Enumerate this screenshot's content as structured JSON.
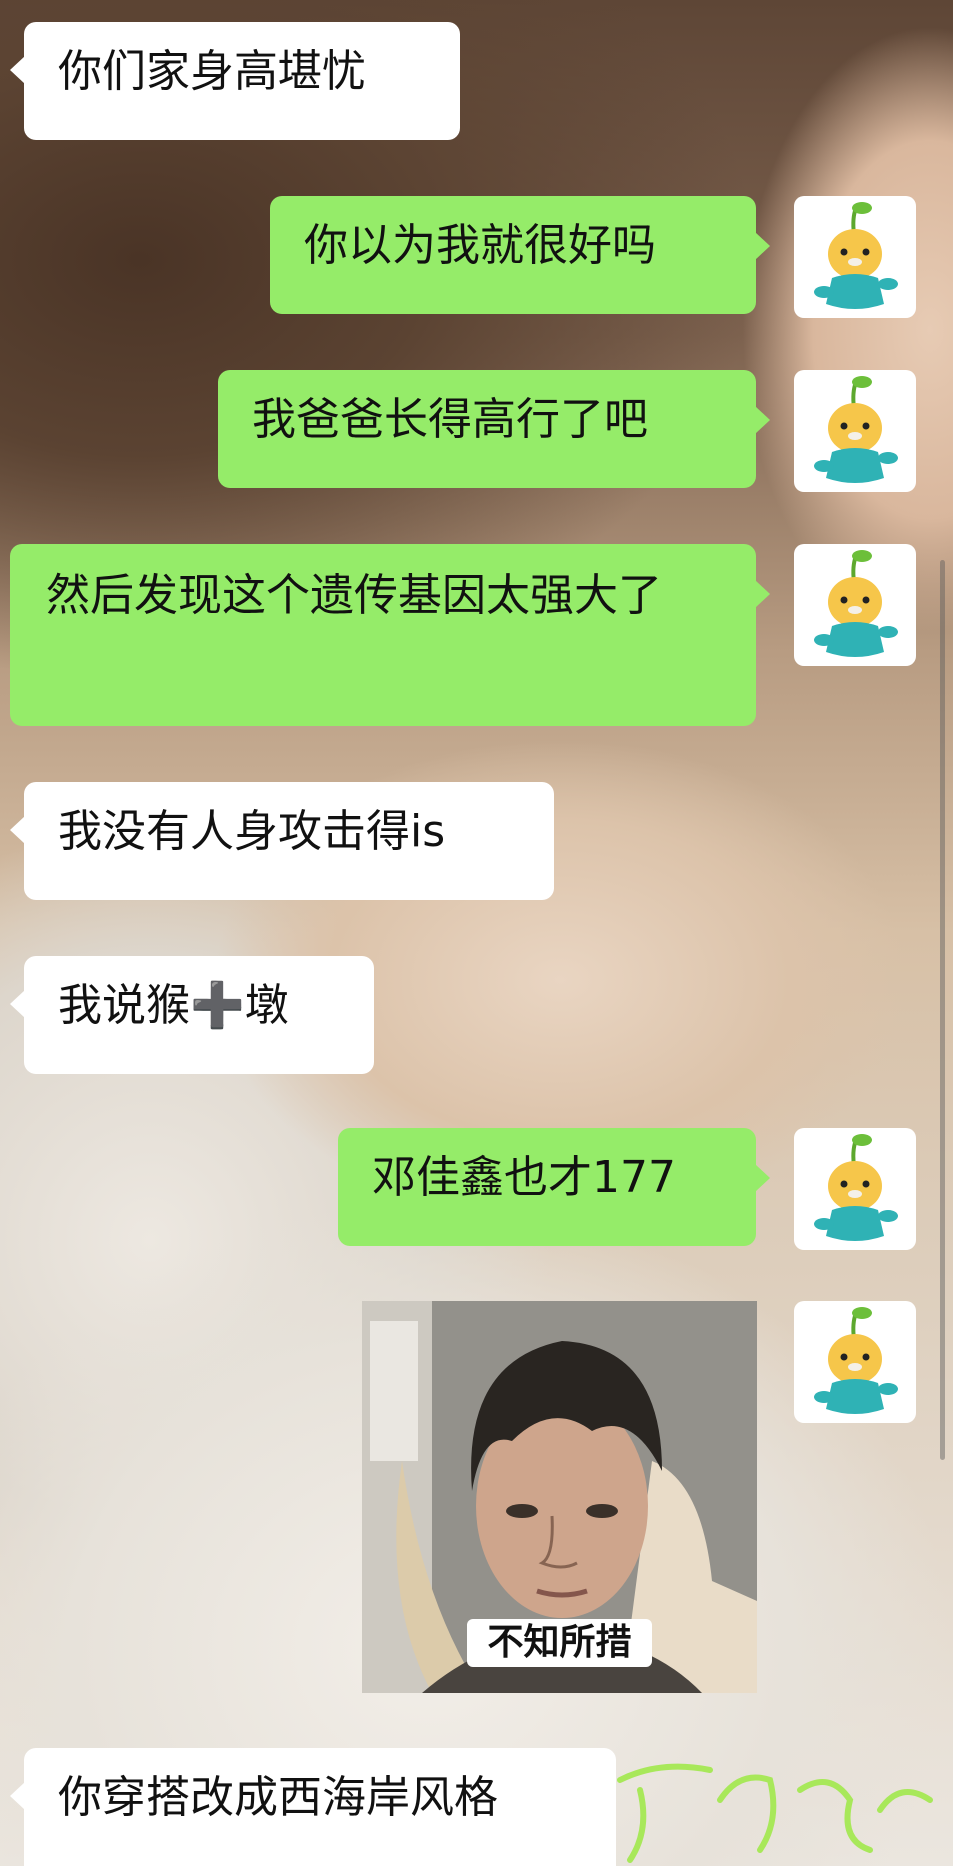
{
  "messages": [
    {
      "side": "left",
      "text": "你们家身高堪忧"
    },
    {
      "side": "right",
      "text": "你以为我就很好吗"
    },
    {
      "side": "right",
      "text": "我爸爸长得高行了吧"
    },
    {
      "side": "right",
      "text": "然后发现这个遗传基因太强大了"
    },
    {
      "side": "left",
      "text": "我没有人身攻击得is"
    },
    {
      "side": "left",
      "text_before": "我说猴",
      "symbol": "➕",
      "text_after": "墩"
    },
    {
      "side": "right",
      "text": "邓佳鑫也才177"
    },
    {
      "side": "right",
      "type": "image",
      "caption": "不知所措"
    },
    {
      "side": "left",
      "text": "你穿搭改成西海岸风格"
    }
  ],
  "avatar_icon": "octonauts-tunip-avatar-icon",
  "colors": {
    "bubble_right": "#95ec69",
    "bubble_left": "#ffffff",
    "text": "#111111"
  }
}
